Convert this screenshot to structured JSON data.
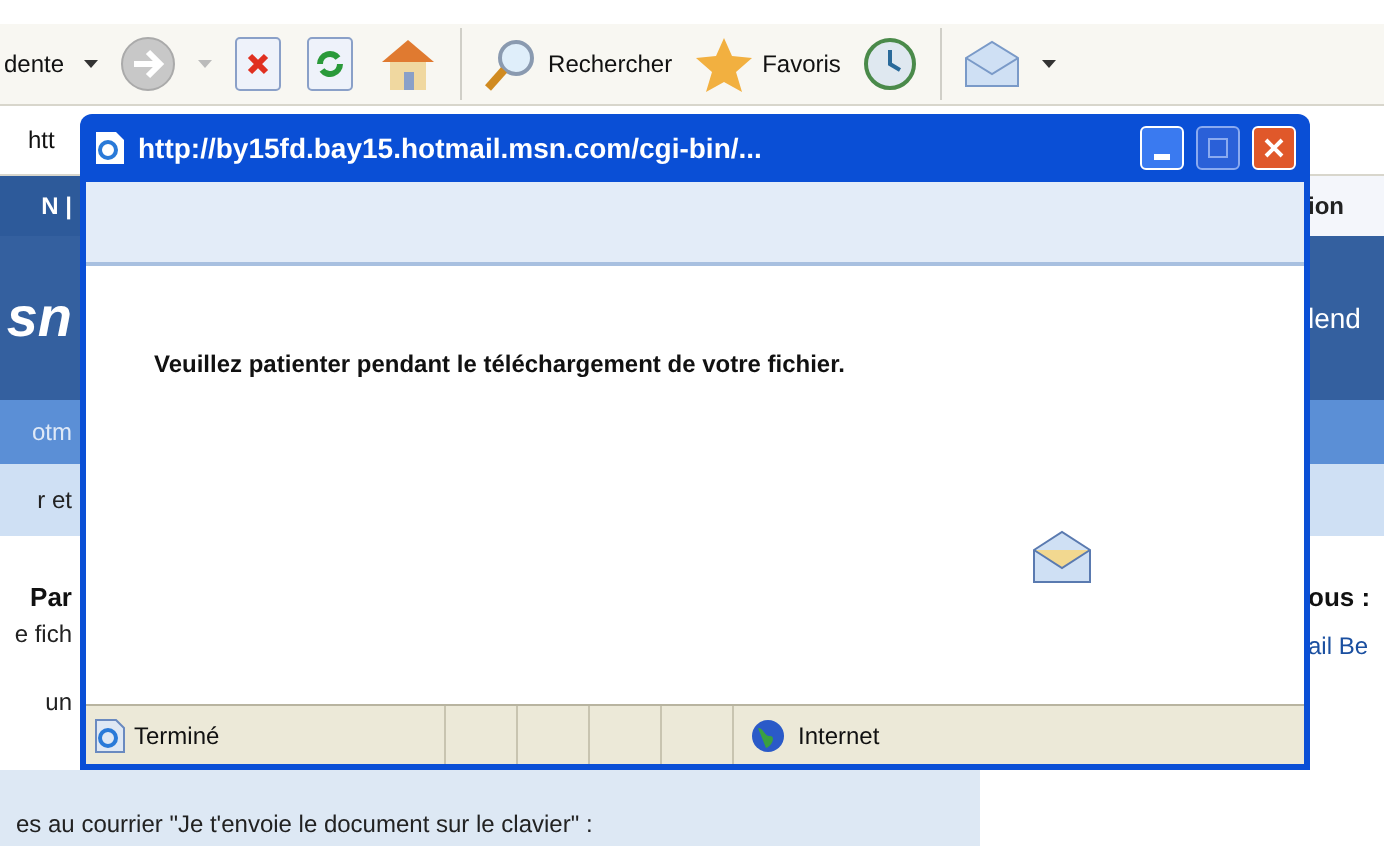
{
  "toolbar": {
    "back_label": "dente",
    "search_label": "Rechercher",
    "favorites_label": "Favoris"
  },
  "address_bar": {
    "value": "htt"
  },
  "page": {
    "left": [
      {
        "kind": "nav",
        "text": "N |"
      },
      {
        "kind": "logo",
        "text": "sn"
      },
      {
        "kind": "link",
        "text": "otm"
      },
      {
        "kind": "tab",
        "text": "r et"
      },
      {
        "kind": "heading",
        "text": "Par"
      },
      {
        "kind": "text",
        "text": "e fich"
      },
      {
        "kind": "text",
        "text": "un"
      }
    ],
    "right": [
      {
        "kind": "nav",
        "text": "ion"
      },
      {
        "kind": "logo",
        "text": "lend"
      },
      {
        "kind": "link"
      },
      {
        "kind": "tab"
      },
      {
        "kind": "heading",
        "text": "ous :"
      },
      {
        "kind": "link",
        "text": "ail Be"
      }
    ],
    "bottom_text": "es au courrier \"Je t'envoie le document sur le clavier\" :"
  },
  "popup": {
    "title": "http://by15fd.bay15.hotmail.msn.com/cgi-bin/...",
    "message": "Veuillez patienter pendant le téléchargement de votre fichier.",
    "status_text": "Terminé",
    "zone": "Internet"
  }
}
